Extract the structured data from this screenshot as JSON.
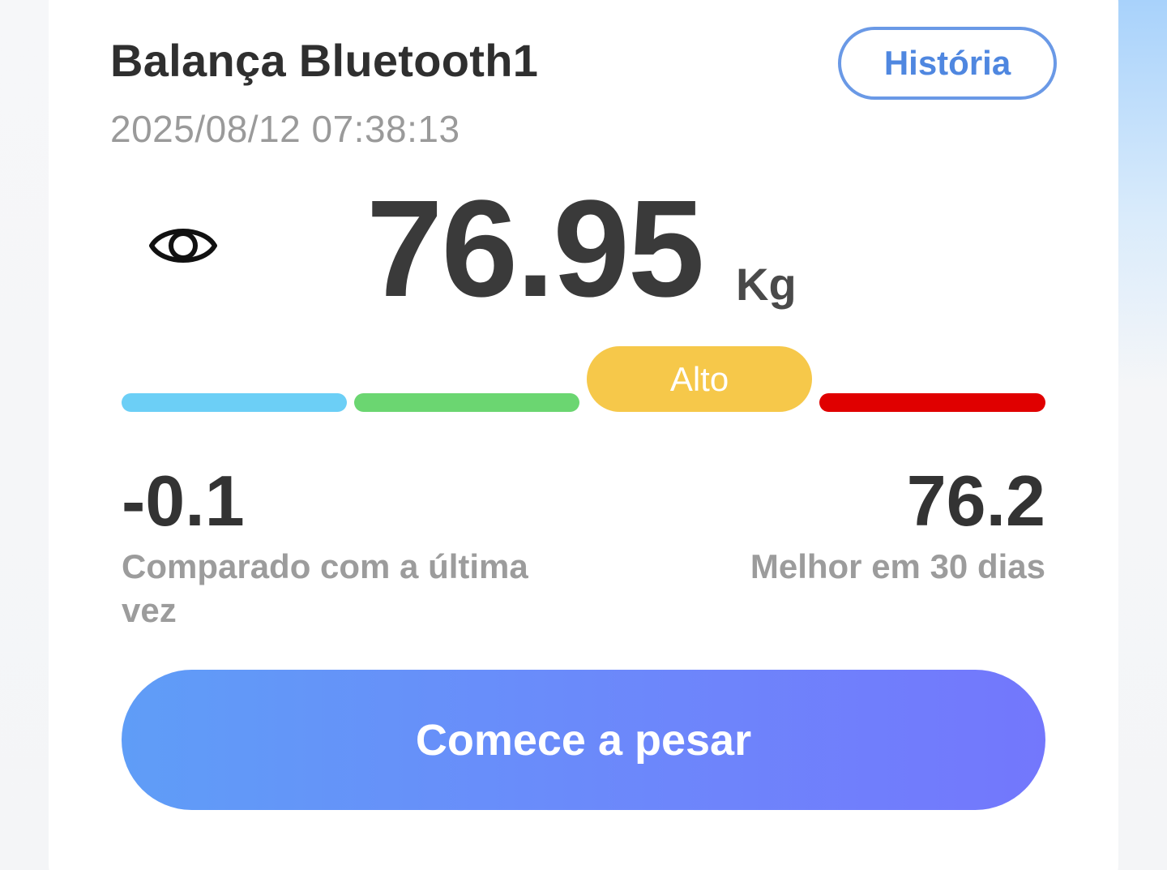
{
  "device": {
    "name": "Balança Bluetooth1",
    "timestamp": "2025/08/12 07:38:13"
  },
  "header": {
    "history_label": "História"
  },
  "measurement": {
    "weight": "76.95",
    "unit": "Kg",
    "status_label": "Alto",
    "status_segment": 3,
    "scale_colors": [
      "#6ccff6",
      "#6bd671",
      "#f6c84a",
      "#e00000"
    ]
  },
  "stats": {
    "change_value": "-0.1",
    "change_label": "Comparado com a última vez",
    "best_value": "76.2",
    "best_label": "Melhor em 30 dias"
  },
  "actions": {
    "start_label": "Comece a pesar"
  },
  "icons": {
    "visibility": "eye-icon"
  },
  "colors": {
    "accent": "#4f87e0",
    "button_gradient": [
      "#5f9df7",
      "#7377fc"
    ]
  }
}
